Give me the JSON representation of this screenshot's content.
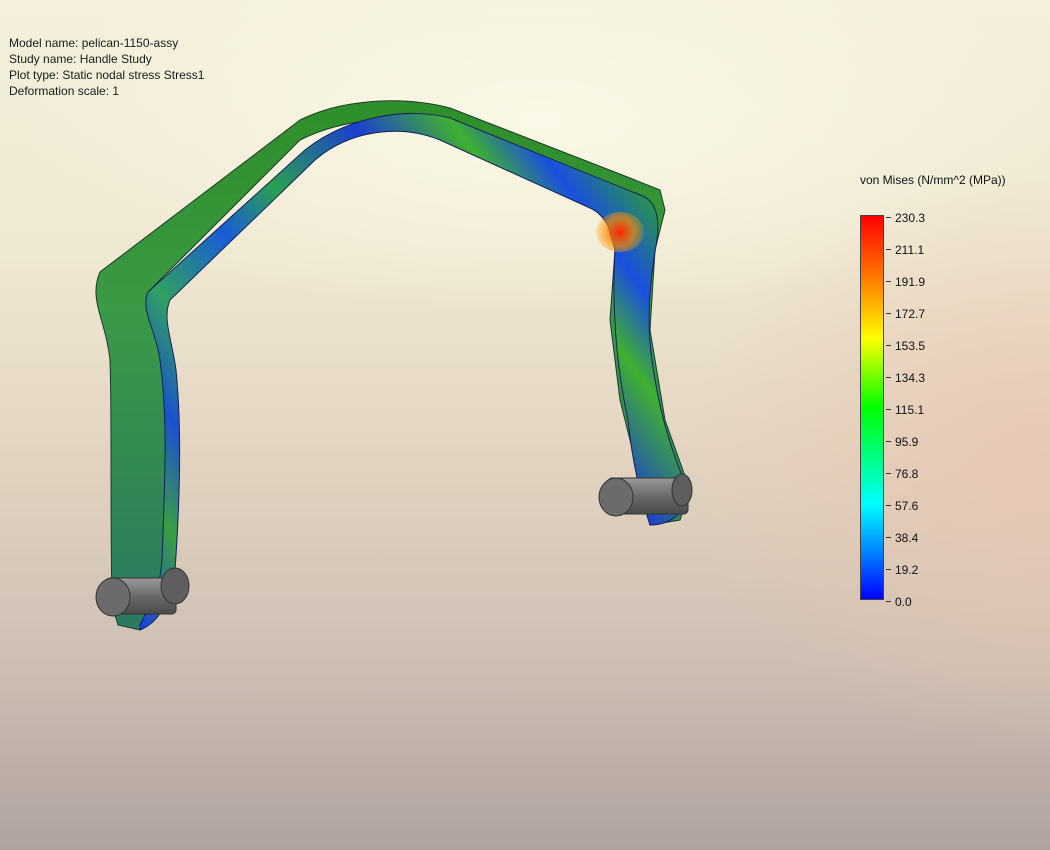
{
  "info": {
    "model_name": "Model name: pelican-1150-assy",
    "study_name": "Study name: Handle Study",
    "plot_type": "Plot type: Static nodal stress Stress1",
    "deformation_scale": "Deformation scale: 1"
  },
  "legend": {
    "title": "von Mises (N/mm^2 (MPa))",
    "ticks": [
      "230.3",
      "211.1",
      "191.9",
      "172.7",
      "153.5",
      "134.3",
      "115.1",
      "95.9",
      "76.8",
      "57.6",
      "38.4",
      "19.2",
      "0.0"
    ]
  },
  "colors": {
    "max_stress": "#ff0000",
    "mid_stress": "#00ff00",
    "min_stress": "#0000ff",
    "pin": "#6e6e6e"
  }
}
